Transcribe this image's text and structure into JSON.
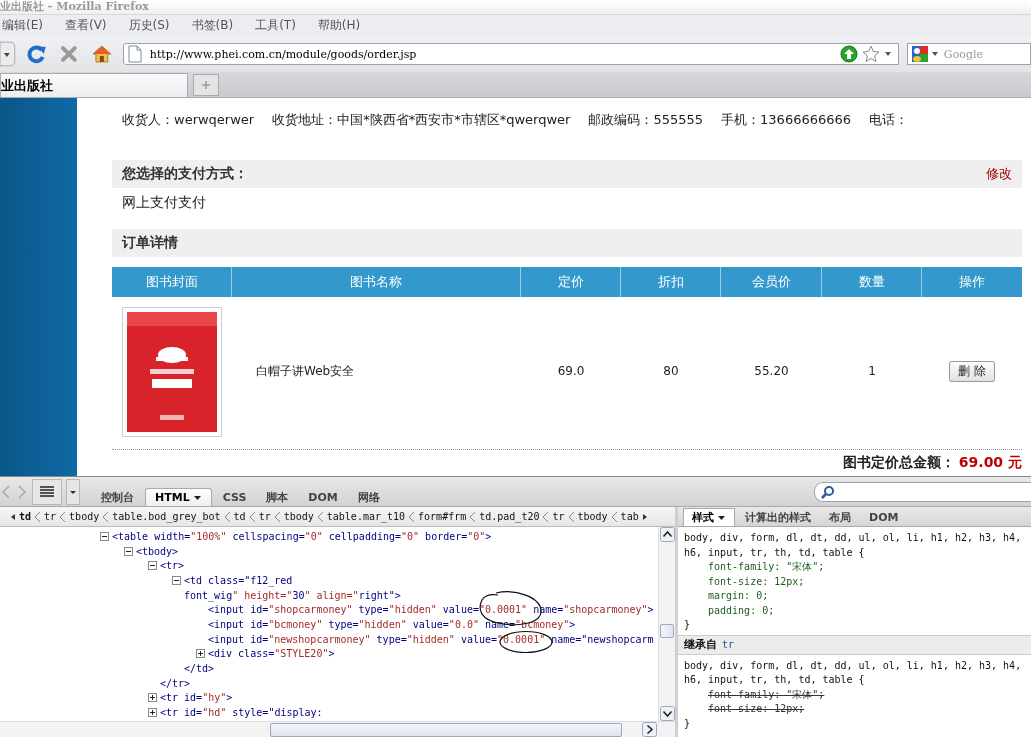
{
  "window": {
    "title": "业出版社 - Mozilla Firefox"
  },
  "menu": [
    "编辑(E)",
    "查看(V)",
    "历史(S)",
    "书签(B)",
    "工具(T)",
    "帮助(H)"
  ],
  "address_bar": {
    "url": "http://www.phei.com.cn/module/goods/order.jsp"
  },
  "search_box": {
    "placeholder": "Google"
  },
  "tabs": [
    {
      "label": "业出版社",
      "selected": true
    }
  ],
  "page": {
    "shipping": [
      {
        "label": "收货人：",
        "value": "werwqerwer"
      },
      {
        "label": "收货地址：",
        "value": "中国*陕西省*西安市*市辖区*qwerqwer"
      },
      {
        "label": "邮政编码：",
        "value": "555555"
      },
      {
        "label": "手机：",
        "value": "13666666666"
      },
      {
        "label": "电话："
      }
    ],
    "payment": {
      "heading": "您选择的支付方式：",
      "edit_link": "修改",
      "method": "网上支付支付"
    },
    "order": {
      "heading": "订单详情",
      "columns": [
        "图书封面",
        "图书名称",
        "定价",
        "折扣",
        "会员价",
        "数量",
        "操作"
      ],
      "rows": [
        {
          "title": "白帽子讲Web安全",
          "price": "69.0",
          "discount": "80",
          "member_price": "55.20",
          "quantity": "1",
          "action": "删 除"
        }
      ]
    },
    "total": {
      "label": "图书定价总金额：",
      "value": "69.00 元"
    }
  },
  "devtools": {
    "tabs": [
      {
        "label": "控制台",
        "selected": false,
        "menu": false
      },
      {
        "label": "HTML",
        "selected": true,
        "menu": true
      },
      {
        "label": "CSS",
        "selected": false,
        "menu": false
      },
      {
        "label": "脚本",
        "selected": false,
        "menu": false
      },
      {
        "label": "DOM",
        "selected": false,
        "menu": false
      },
      {
        "label": "网络",
        "selected": false,
        "menu": false
      }
    ],
    "breadcrumb": [
      {
        "label": "td",
        "selected": true
      },
      {
        "label": "tr",
        "selected": false
      },
      {
        "label": "tbody",
        "selected": false
      },
      {
        "label": "table.bod_grey_bot",
        "selected": false
      },
      {
        "label": "td",
        "selected": false
      },
      {
        "label": "tr",
        "selected": false
      },
      {
        "label": "tbody",
        "selected": false
      },
      {
        "label": "table.mar_t10",
        "selected": false
      },
      {
        "label": "form#frm",
        "selected": false
      },
      {
        "label": "td.pad_t20",
        "selected": false
      },
      {
        "label": "tr",
        "selected": false
      },
      {
        "label": "tbody",
        "selected": false
      },
      {
        "label": "tab",
        "selected": false
      }
    ],
    "tree": [
      {
        "text_lines": [
          "<table width=\"100%\" cellspacing=\"0\" cellpadding=\"0\" border=\"0\">"
        ],
        "expanded": true,
        "children": [
          {
            "text_lines": [
              "<tbody>"
            ],
            "expanded": true,
            "children": [
              {
                "text_lines": [
                  "<tr>"
                ],
                "expanded": true,
                "close": "</tr>",
                "children": [
                  {
                    "text_lines": [
                      "<td class=\"f12_red",
                      "font_wig\" height=\"30\" align=\"right\">"
                    ],
                    "expanded": true,
                    "close": "</td>",
                    "children": [
                      {
                        "text_lines": [
                          "<input id=\"shopcarmoney\" type=\"hidden\" value=\"0.0001\" name=\"shopcarmoney\">"
                        ]
                      },
                      {
                        "text_lines": [
                          "<input id=\"bcmoney\" type=\"hidden\" value=\"0.0\" name=\"bcmoney\">"
                        ]
                      },
                      {
                        "text_lines": [
                          "<input id=\"newshopcarmoney\" type=\"hidden\" value=\"0.0001\" name=\"newshopcarm"
                        ]
                      },
                      {
                        "text_lines": [
                          "<div class=\"STYLE20\">"
                        ],
                        "expanded": false
                      }
                    ]
                  }
                ]
              },
              {
                "text_lines": [
                  "<tr id=\"hy\">"
                ],
                "expanded": false
              },
              {
                "text_lines": [
                  "<tr id=\"hd\" style=\"display:"
                ],
                "expanded": false
              }
            ]
          }
        ]
      }
    ],
    "side_tabs": [
      {
        "label": "样式",
        "selected": true,
        "menu": true
      },
      {
        "label": "计算出的样式",
        "selected": false,
        "menu": false
      },
      {
        "label": "布局",
        "selected": false,
        "menu": false
      },
      {
        "label": "DOM",
        "selected": false,
        "menu": false
      }
    ],
    "style_sections": [
      {
        "selector_lines": [
          "body, div, form, dl, dt, dd, ul, ol, li, h1, h2, h3, h4,",
          "h6, input, tr, th, td, table {"
        ],
        "properties": [
          {
            "text": "font-family: \"宋体\";",
            "overridden": false
          },
          {
            "text": "font-size: 12px;",
            "overridden": false
          },
          {
            "text": "margin: 0;",
            "overridden": false
          },
          {
            "text": "padding: 0;",
            "overridden": false
          }
        ],
        "closing": "}"
      },
      {
        "heading": "继承自",
        "source": "tr",
        "selector_lines": [
          "body, div, form, dl, dt, dd, ul, ol, li, h1, h2, h3, h4,",
          "h6, input, tr, th, td, table {"
        ],
        "properties": [
          {
            "text": "font-family: \"宋体\";",
            "overridden": true
          },
          {
            "text": "font-size: 12px;",
            "overridden": true
          }
        ],
        "closing": "}"
      }
    ]
  }
}
